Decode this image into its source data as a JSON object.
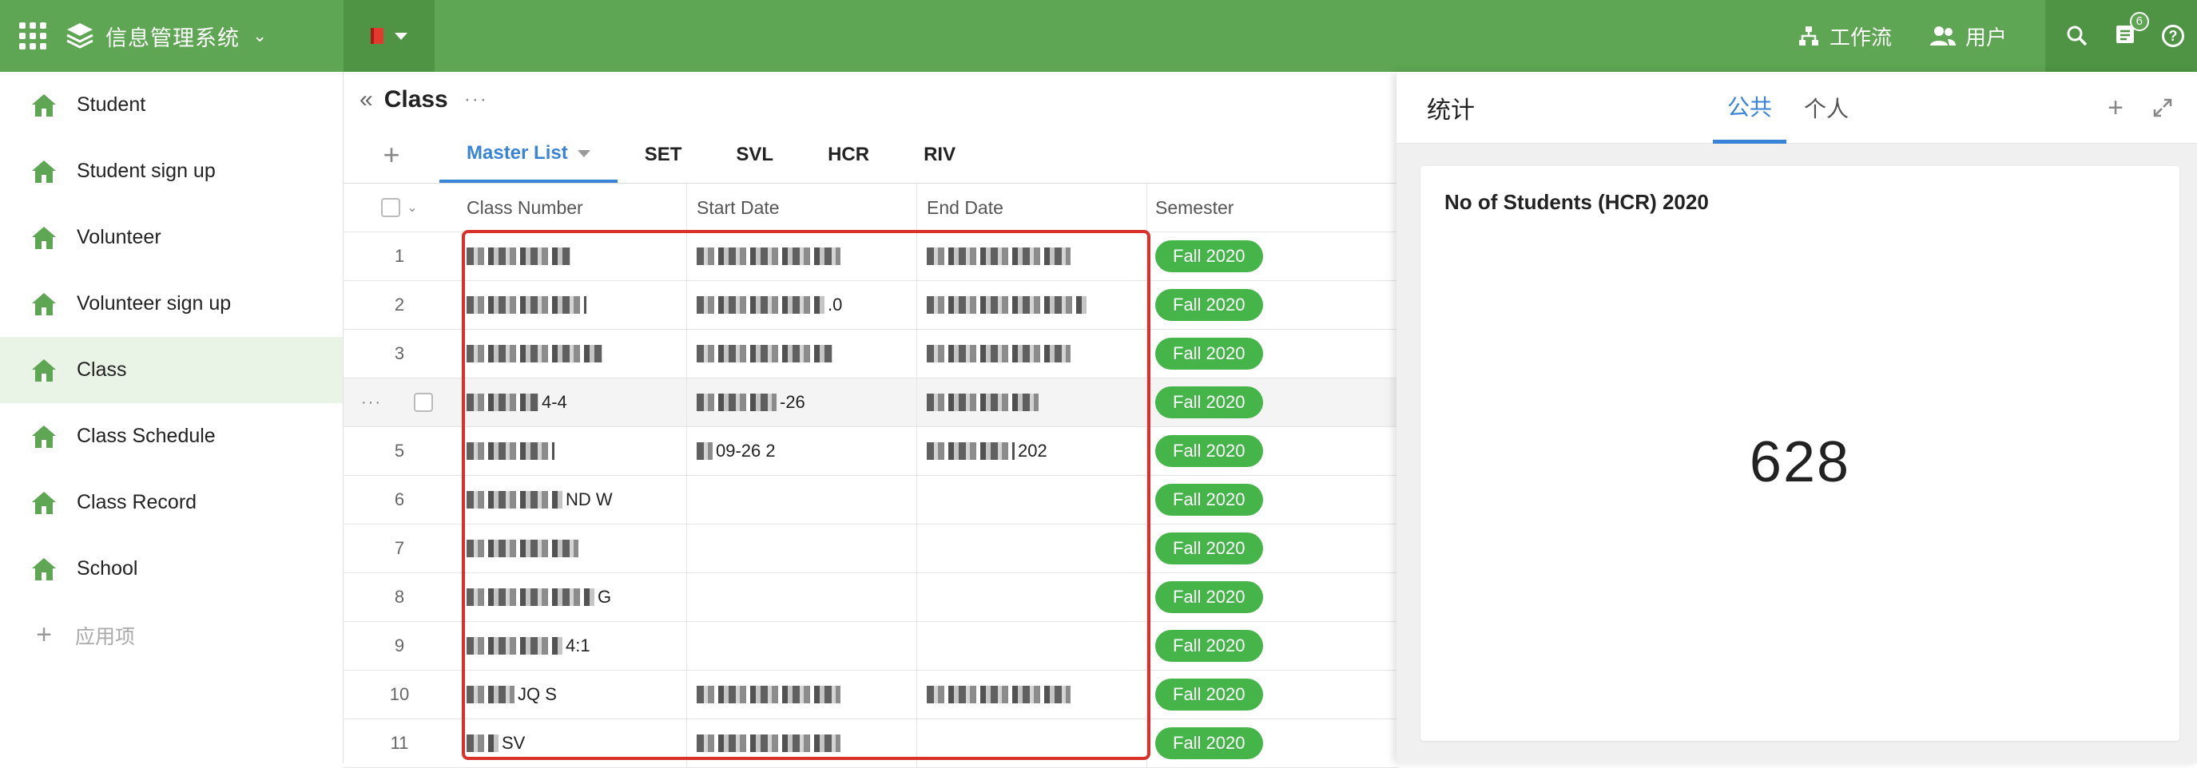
{
  "app": {
    "title": "信息管理系统"
  },
  "topbar": {
    "workflow_label": "工作流",
    "users_label": "用户",
    "notification_count": "6",
    "help_label": "?"
  },
  "sidebar": {
    "items": [
      {
        "label": "Student"
      },
      {
        "label": "Student sign up"
      },
      {
        "label": "Volunteer"
      },
      {
        "label": "Volunteer sign up"
      },
      {
        "label": "Class"
      },
      {
        "label": "Class Schedule"
      },
      {
        "label": "Class Record"
      },
      {
        "label": "School"
      }
    ],
    "add_label": "应用项",
    "active_index": 4,
    "icon_color": "#5ea653"
  },
  "main": {
    "title": "Class",
    "tabs": [
      {
        "label": "Master List"
      },
      {
        "label": "SET"
      },
      {
        "label": "SVL"
      },
      {
        "label": "HCR"
      },
      {
        "label": "RIV"
      }
    ],
    "table": {
      "headers": [
        "Class Number",
        "Start Date",
        "End Date",
        "Semester"
      ],
      "rows": [
        {
          "num": "1",
          "cls_text": "",
          "sd_text": "",
          "ed_text": "",
          "semester": "Fall 2020"
        },
        {
          "num": "2",
          "cls_text": "",
          "sd_text": ".0",
          "ed_text": "",
          "semester": "Fall 2020"
        },
        {
          "num": "3",
          "cls_text": "",
          "sd_text": "",
          "ed_text": "",
          "semester": "Fall 2020"
        },
        {
          "num": "4",
          "cls_text": "4-4",
          "sd_text": "-26",
          "ed_text": "",
          "semester": "Fall 2020"
        },
        {
          "num": "5",
          "cls_text": "",
          "sd_text": "09-26 2",
          "ed_text": "202",
          "semester": "Fall 2020"
        },
        {
          "num": "6",
          "cls_text": "ND W",
          "sd_text": "",
          "ed_text": "",
          "semester": "Fall 2020"
        },
        {
          "num": "7",
          "cls_text": "",
          "sd_text": "",
          "ed_text": "",
          "semester": "Fall 2020"
        },
        {
          "num": "8",
          "cls_text": "G",
          "sd_text": "",
          "ed_text": "",
          "semester": "Fall 2020"
        },
        {
          "num": "9",
          "cls_text": "4:1",
          "sd_text": "",
          "ed_text": "",
          "semester": "Fall 2020"
        },
        {
          "num": "10",
          "cls_text": "JQ S",
          "sd_text": "",
          "ed_text": "",
          "semester": "Fall 2020"
        },
        {
          "num": "11",
          "cls_text": "SV",
          "sd_text": "",
          "ed_text": "",
          "semester": "Fall 2020"
        }
      ]
    },
    "accent_color": "#3a84d8",
    "pill_color": "#45b54a",
    "highlight_color": "#d8312a"
  },
  "panel": {
    "title": "统计",
    "tab_public": "公共",
    "tab_personal": "个人",
    "card": {
      "title": "No of Students (HCR) 2020",
      "value": "628"
    }
  }
}
